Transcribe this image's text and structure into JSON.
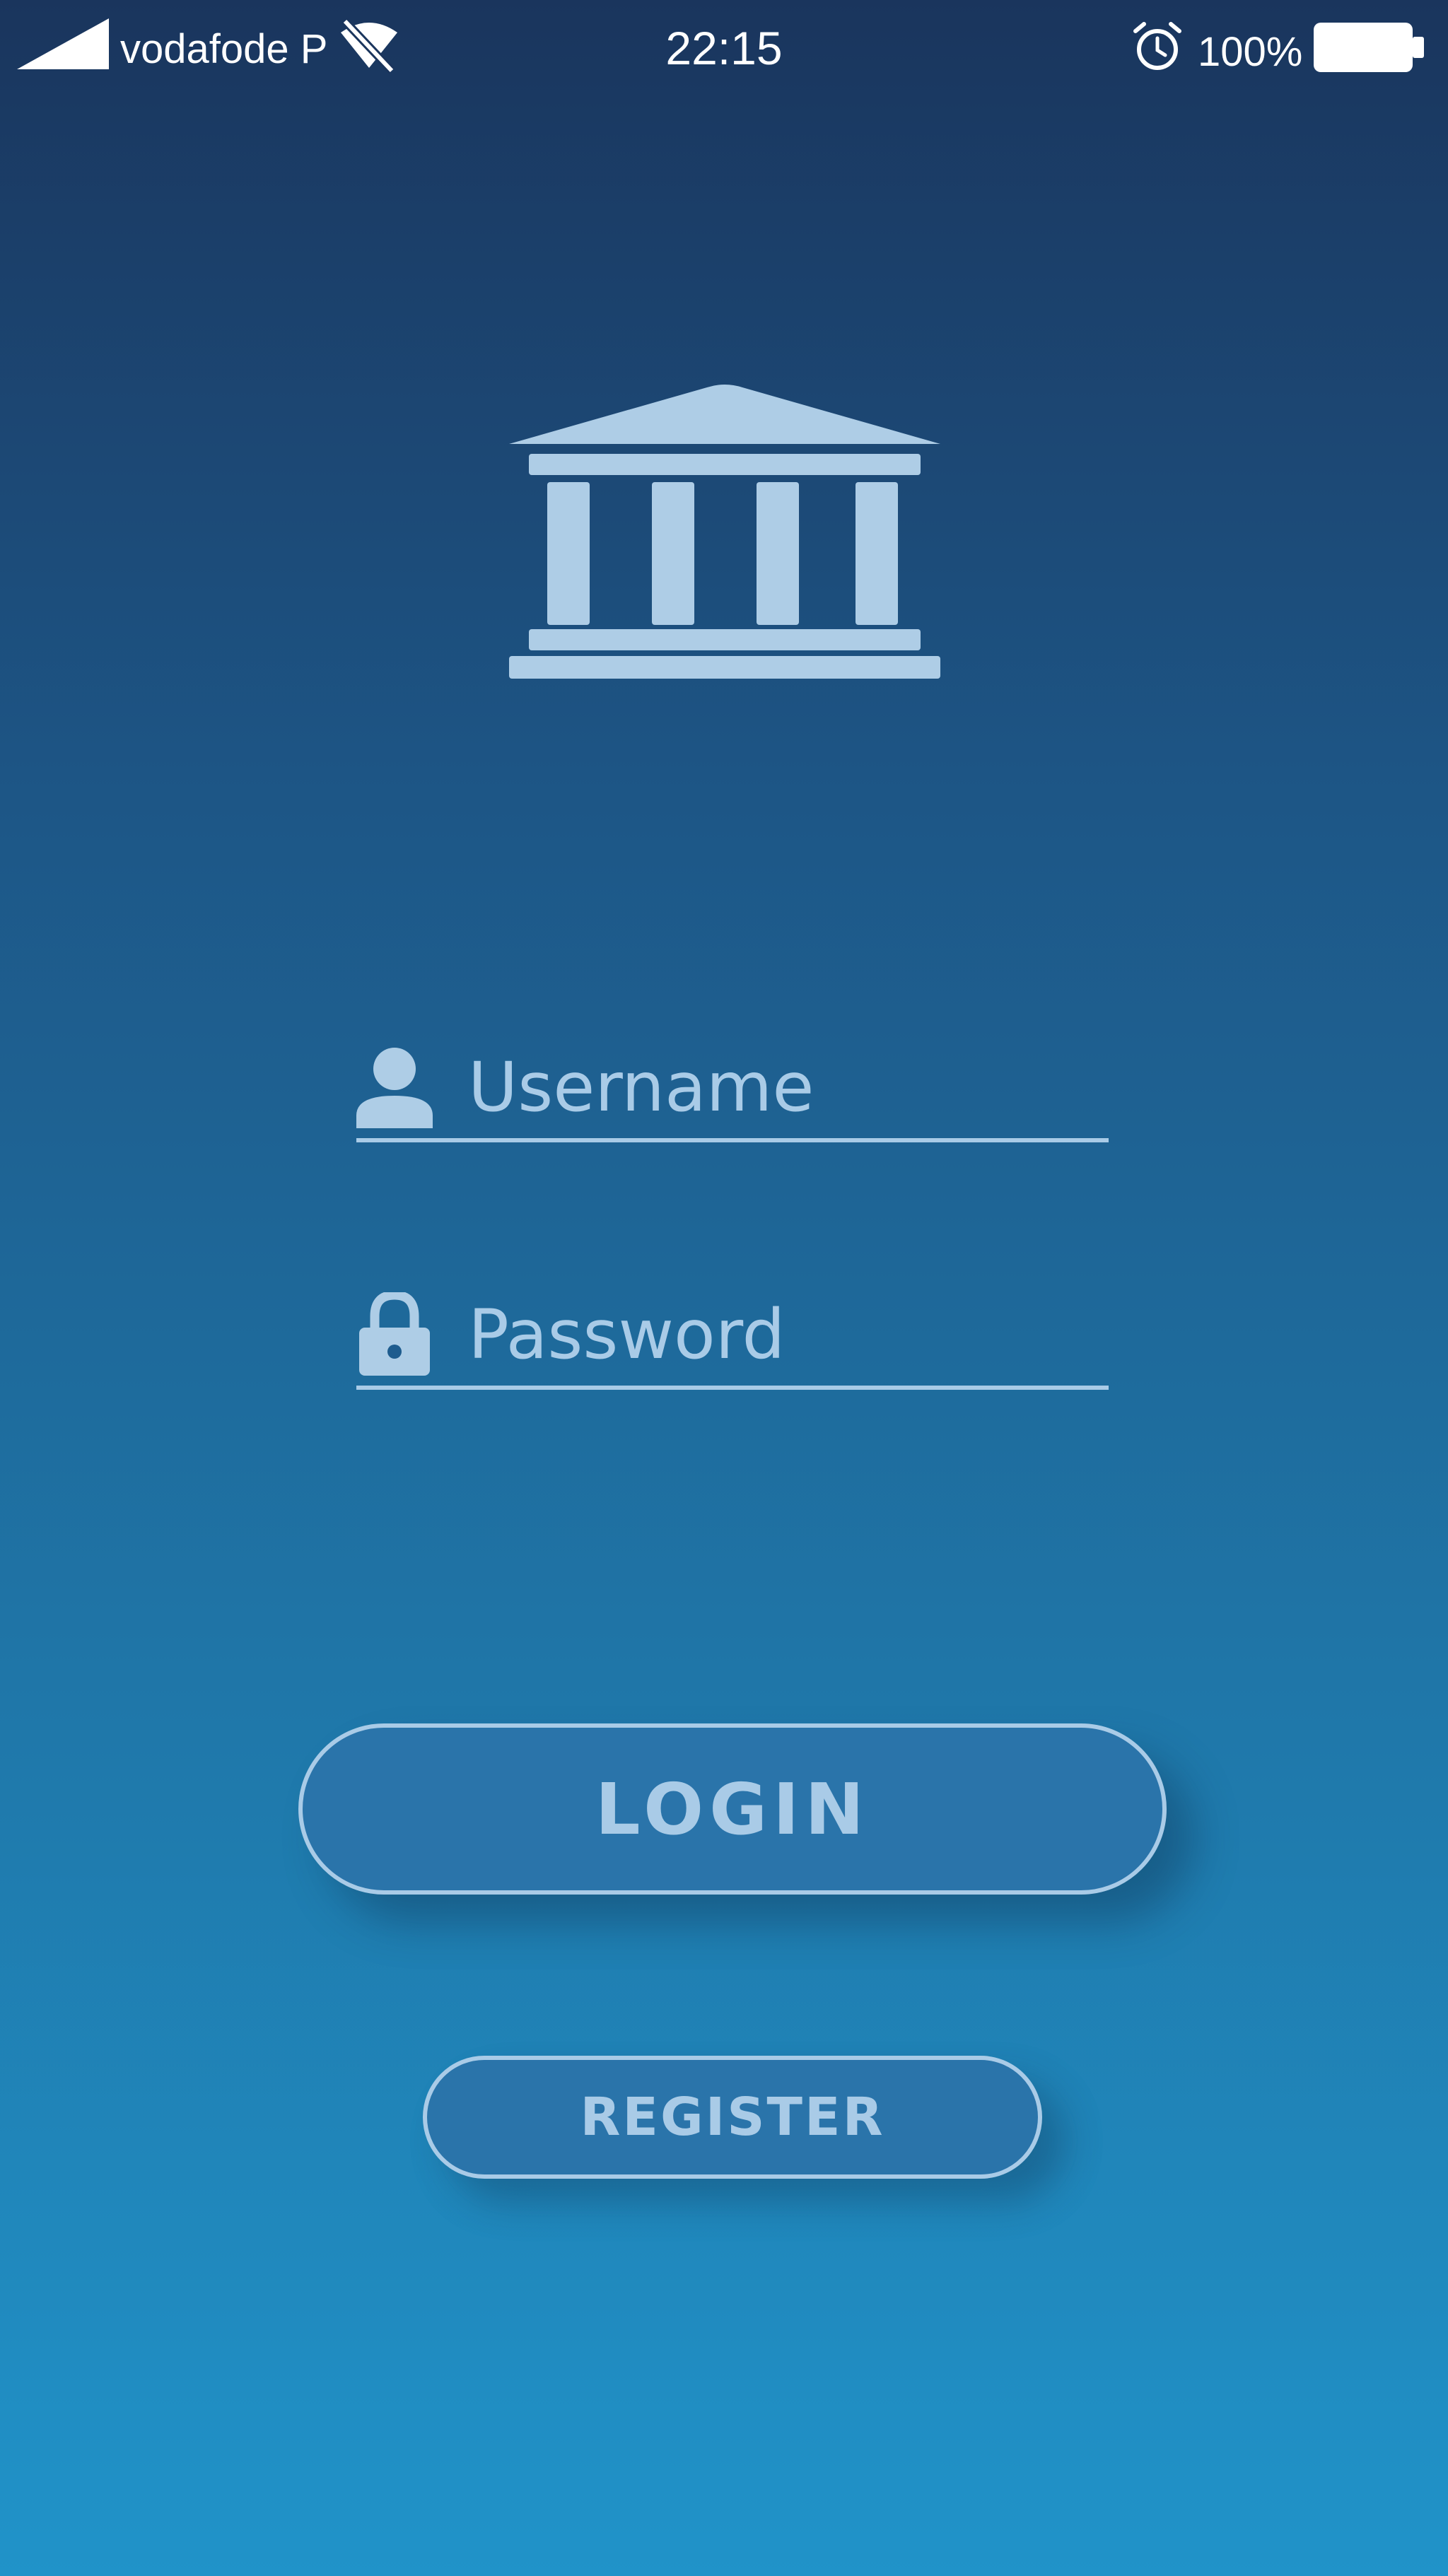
{
  "status_bar": {
    "carrier": "vodafode P",
    "time": "22:15",
    "battery_percent": "100%",
    "battery_level": 1.0,
    "icons": [
      "signal-icon",
      "wifi-off-icon",
      "alarm-icon",
      "battery-icon"
    ]
  },
  "logo": {
    "icon": "bank-building-icon",
    "color": "#aecde6"
  },
  "form": {
    "username": {
      "placeholder": "Username",
      "value": "",
      "icon": "user-icon"
    },
    "password": {
      "placeholder": "Password",
      "value": "",
      "icon": "lock-icon"
    }
  },
  "buttons": {
    "login_label": "LOGIN",
    "register_label": "REGISTER"
  },
  "colors": {
    "background_top": "#1a355d",
    "background_bottom": "#2093c9",
    "accent": "#a9cbe7",
    "button_fill": "#2a74aa"
  }
}
